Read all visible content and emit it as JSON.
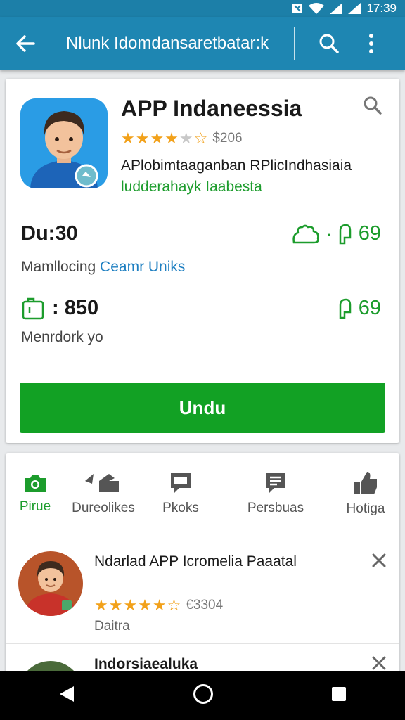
{
  "status_bar": {
    "time": "17:39"
  },
  "app_bar": {
    "title": "Nlunk Idomdansaretbatar:k"
  },
  "app": {
    "name": "APP Indaneessia",
    "rating_stars": 3.5,
    "rating_count": "$206",
    "description_line1": "APlobimtaaganban RPlicIndhasiaia",
    "description_line2": "ludderahayk Iaabesta",
    "duration": "Du:30",
    "likes_count": "69",
    "meta_label": "Mamllocing",
    "meta_link": "Ceamr Uniks",
    "size_value": ": 850",
    "size_likes": "69",
    "meta2": "Menrdork yo",
    "install_label": "Undu"
  },
  "tabs": [
    {
      "label": "Pirue",
      "icon": "camera-icon",
      "active": true
    },
    {
      "label": "Dureolikes",
      "icon": "share-icon",
      "active": false
    },
    {
      "label": "Pkoks",
      "icon": "chat-icon",
      "active": false
    },
    {
      "label": "Persbuas",
      "icon": "review-icon",
      "active": false
    },
    {
      "label": "Hotiga",
      "icon": "thumbs-up-icon",
      "active": false
    }
  ],
  "reviews": [
    {
      "title": "Ndarlad APP Icromelia Paaatal",
      "rating_stars": 4.5,
      "rating_count": "€3304",
      "author": "Daitra"
    },
    {
      "title": "Indorsiaealuka"
    }
  ],
  "colors": {
    "primary": "#1e86b2",
    "accent_green": "#12a124",
    "star": "#f2a11a"
  }
}
